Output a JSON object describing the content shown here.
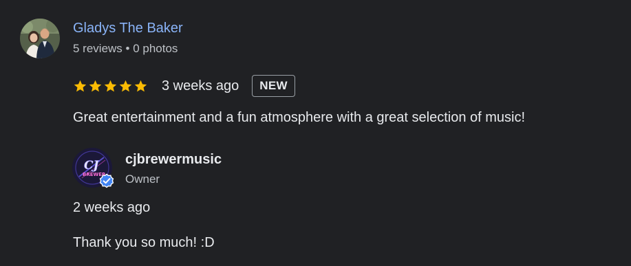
{
  "review": {
    "reviewer": {
      "name": "Gladys The Baker",
      "meta": "5 reviews • 0 photos",
      "avatar_icon": "reviewer-photo"
    },
    "rating": {
      "stars": 5,
      "max": 5,
      "color": "#fbbc04"
    },
    "date": "3 weeks ago",
    "badge": "NEW",
    "text": "Great entertainment and a fun atmosphere with a great selection of music!"
  },
  "owner_response": {
    "name": "cjbrewermusic",
    "role": "Owner",
    "logo_text": "CJ",
    "logo_subtext": "BREWER",
    "date": "2 weeks ago",
    "text": "Thank you so much! :D",
    "verified_color": "#4285f4"
  },
  "colors": {
    "background": "#202124",
    "link": "#8ab4f8",
    "text": "#e8eaed",
    "secondary_text": "#bdc1c6"
  }
}
